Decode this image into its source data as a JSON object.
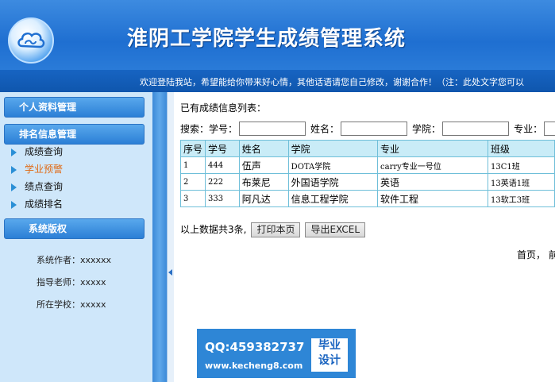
{
  "header": {
    "title": "淮阴工学院学生成绩管理系统",
    "logo_icon": "cloud-logo-icon"
  },
  "marquee": {
    "text": "欢迎登陆我站，希望能给你带来好心情，其他话语请您自己修改，谢谢合作！（注：此处文字您可以"
  },
  "sidebar": {
    "sections": [
      {
        "title": "个人资料管理"
      },
      {
        "title": "排名信息管理"
      },
      {
        "title": "系统版权"
      }
    ],
    "items": [
      {
        "label": "成绩查询"
      },
      {
        "label": "学业预警"
      },
      {
        "label": "绩点查询"
      },
      {
        "label": "成绩排名"
      }
    ],
    "info": [
      {
        "label": "系统作者：xxxxxx"
      },
      {
        "label": "指导老师：xxxxx"
      },
      {
        "label": "所在学校：xxxxx"
      }
    ]
  },
  "main": {
    "list_title": "已有成绩信息列表：",
    "search": {
      "prefix": "搜索：",
      "fields": [
        {
          "label": "学号：",
          "value": ""
        },
        {
          "label": "姓名：",
          "value": ""
        },
        {
          "label": "学院：",
          "value": ""
        },
        {
          "label": "专业：",
          "value": ""
        }
      ]
    },
    "table": {
      "headers": [
        "序号",
        "学号",
        "姓名",
        "学院",
        "专业",
        "班级"
      ],
      "rows": [
        [
          "1",
          "444",
          "伍声",
          "DOTA学院",
          "carry专业一号位",
          "13C1班"
        ],
        [
          "2",
          "222",
          "布莱尼",
          "外国语学院",
          "英语",
          "13英语1班"
        ],
        [
          "3",
          "333",
          "阿凡达",
          "信息工程学院",
          "软件工程",
          "13软工3班"
        ]
      ]
    },
    "count_text": "以上数据共3条,",
    "print_button": "打印本页",
    "export_button": "导出EXCEL",
    "pager": "首页，  前"
  },
  "watermark": {
    "qq": "QQ:459382737",
    "site": "www.kecheng8.com",
    "badge_line1": "毕业",
    "badge_line2": "设计"
  },
  "colors": {
    "header_blue": "#1f6fd1",
    "sidebar_bg": "#cfe7fa",
    "table_header": "#c9ecf7",
    "active_item": "#e06a14"
  }
}
